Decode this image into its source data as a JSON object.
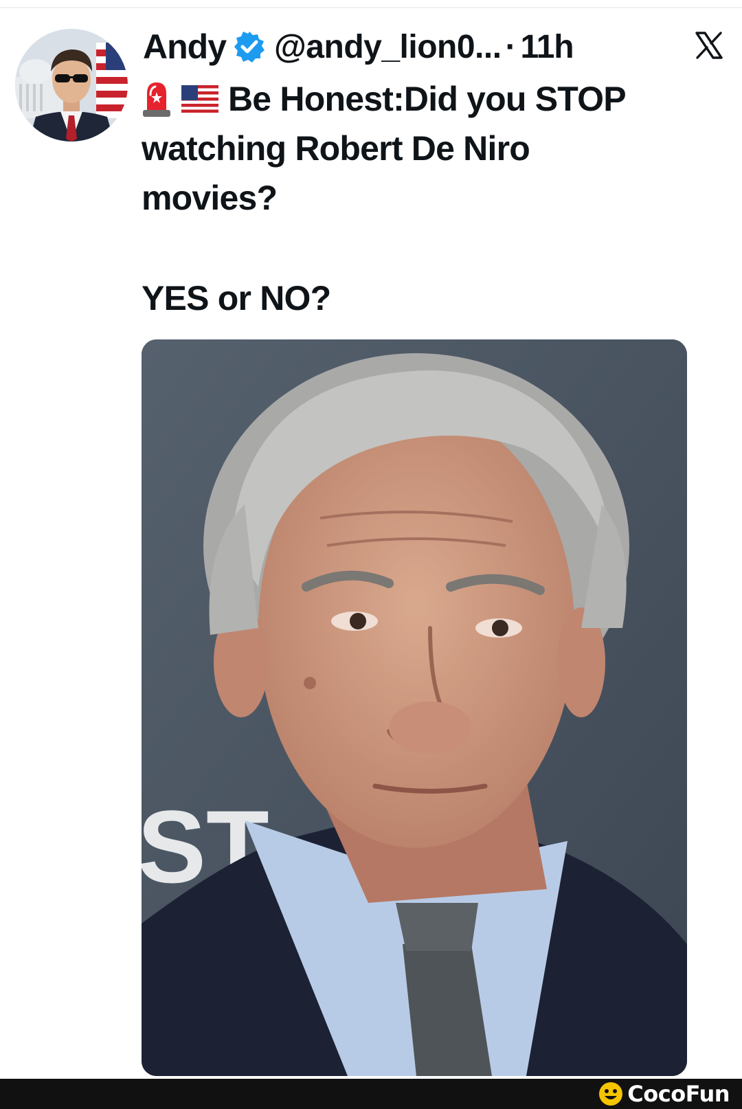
{
  "tweet": {
    "author": {
      "display_name": "Andy",
      "handle": "@andy_lion0...",
      "verified": true,
      "avatar_icon": "avatar-man-sunglasses-flag"
    },
    "separator": "·",
    "timestamp": "11h",
    "platform_icon": "x-logo-icon",
    "text_lines": [
      "Be Honest:Did you STOP",
      "watching Robert De Niro",
      "movies?"
    ],
    "emojis": [
      "police-siren-icon",
      "us-flag-icon"
    ],
    "question": "YES or NO?",
    "media": {
      "type": "photo",
      "visible_text": "ST"
    }
  },
  "watermark": {
    "brand_name": "CocoFun",
    "brand_icon": "cocofun-smiley-icon",
    "accent_color": "#f4c400"
  },
  "colors": {
    "verified_badge": "#1d9bf0",
    "text": "#0f1419",
    "background": "#ffffff",
    "bottom_bar": "#111111"
  }
}
